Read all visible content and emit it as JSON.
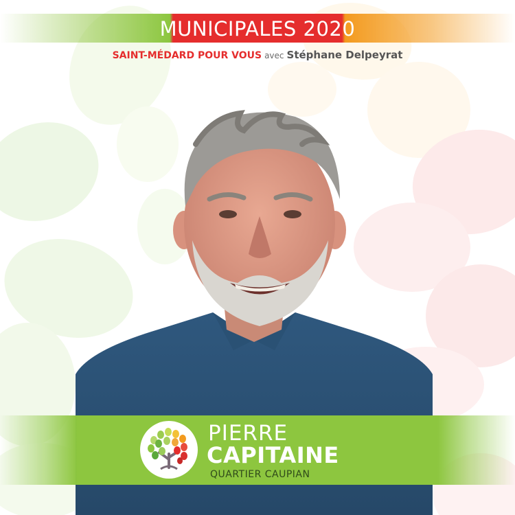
{
  "header": {
    "title": "MUNICIPALES 2020",
    "list_name": "SAINT-MÉDARD POUR VOUS",
    "avec": "avec",
    "lead_candidate": "Stéphane Delpeyrat"
  },
  "candidate": {
    "first_name": "PIERRE",
    "last_name": "CAPITAINE",
    "district": "QUARTIER CAUPIAN"
  },
  "colors": {
    "green": "#8dc63f",
    "red": "#e52d2d",
    "orange": "#f39a1e"
  },
  "icons": {
    "logo": "tree-logo-icon"
  }
}
